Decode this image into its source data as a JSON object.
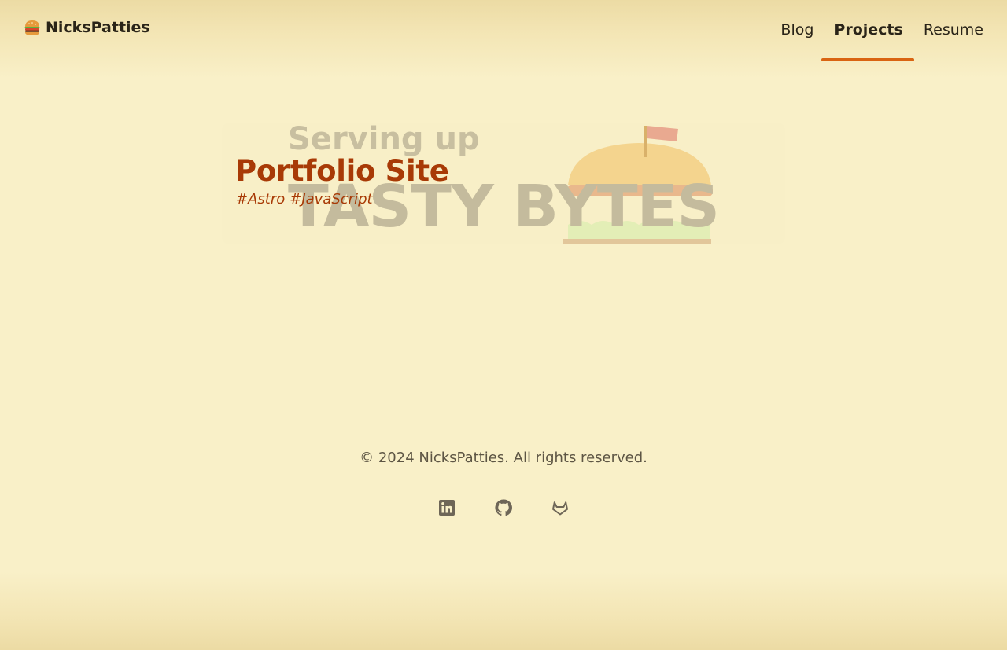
{
  "header": {
    "brand": "NicksPatties",
    "brand_icon": "burger-icon",
    "nav": [
      {
        "label": "Blog",
        "active": false
      },
      {
        "label": "Projects",
        "active": true
      },
      {
        "label": "Resume",
        "active": false
      }
    ]
  },
  "project": {
    "title": "Portfolio Site",
    "tags": [
      "#Astro",
      "#JavaScript"
    ],
    "image_text_small": "Serving up",
    "image_text_large": "TASTY BYTES"
  },
  "footer": {
    "copyright": "© 2024 NicksPatties. All rights reserved.",
    "social": [
      "linkedin-icon",
      "github-icon",
      "gitlab-icon"
    ]
  },
  "colors": {
    "background": "#f9f0c8",
    "accent": "#d96412",
    "title": "#a83a06",
    "icon": "#6e6657"
  }
}
